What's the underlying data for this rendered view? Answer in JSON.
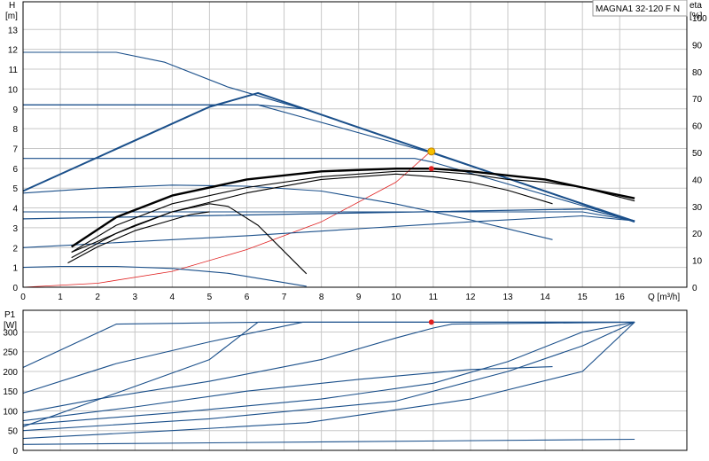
{
  "colors": {
    "curve": "#1a4f8a",
    "eta": "#000000",
    "system": "#e02020",
    "point": "#e02020",
    "point_top": "#f5c000",
    "grid": "#c8c8c8",
    "frame": "#000000"
  },
  "chart_data": [
    {
      "type": "line",
      "title": "MAGNA1 32-120 F N",
      "ylabel": "H",
      "yunit": "[m]",
      "y2label": "eta",
      "y2unit": "[%]",
      "xlabel": "Q [m³/h]",
      "xlim": [
        0,
        17.8
      ],
      "ylim": [
        0,
        14.4
      ],
      "y2lim": [
        0,
        100
      ],
      "x_ticks": [
        "0",
        "1",
        "2",
        "3",
        "4",
        "5",
        "6",
        "7",
        "8",
        "9",
        "10",
        "11",
        "12",
        "13",
        "14",
        "15",
        "16"
      ],
      "y_ticks": [
        "0",
        "1",
        "2",
        "3",
        "4",
        "5",
        "6",
        "7",
        "8",
        "9",
        "10",
        "11",
        "12",
        "13"
      ],
      "y2_ticks": [
        "0",
        "10",
        "20",
        "30",
        "40",
        "50",
        "60",
        "70",
        "80",
        "90",
        "100"
      ],
      "grid": true,
      "head_curves": [
        {
          "x": [
            0,
            2.5,
            3.8,
            5.5,
            7.5
          ],
          "y": [
            11.85,
            11.85,
            11.35,
            10.1,
            9.0
          ]
        },
        {
          "x": [
            0,
            6.3,
            10.9,
            16.4
          ],
          "y": [
            9.2,
            9.2,
            6.8,
            3.35
          ]
        },
        {
          "x": [
            0,
            6.3,
            7.5
          ],
          "y": [
            9.2,
            9.2,
            9.0
          ]
        },
        {
          "x": [
            0,
            10.5,
            11,
            16.4
          ],
          "y": [
            6.5,
            6.5,
            6.3,
            3.35
          ]
        },
        {
          "x": [
            0,
            2,
            4,
            6,
            8,
            10,
            12,
            14.2
          ],
          "y": [
            4.75,
            5.0,
            5.15,
            5.1,
            4.85,
            4.2,
            3.4,
            2.4
          ]
        },
        {
          "x": [
            0,
            2,
            5,
            10,
            15,
            16.4
          ],
          "y": [
            3.8,
            3.8,
            3.8,
            3.8,
            3.8,
            3.35
          ]
        },
        {
          "x": [
            0,
            3,
            6,
            9,
            12,
            15,
            16.4
          ],
          "y": [
            2.0,
            2.3,
            2.6,
            2.95,
            3.3,
            3.6,
            3.35
          ]
        },
        {
          "x": [
            0,
            1,
            2.5,
            4,
            5.5,
            7.6
          ],
          "y": [
            1.0,
            1.05,
            1.05,
            0.95,
            0.7,
            0.05
          ]
        }
      ],
      "max_head_limit": {
        "x": [
          0,
          5,
          6.3,
          16.4
        ],
        "y": [
          4.85,
          9.1,
          9.8,
          3.3
        ]
      },
      "min_head_limit": {
        "x": [
          0,
          15.1,
          16.4
        ],
        "y": [
          3.45,
          3.95,
          3.35
        ]
      },
      "eta_curves": [
        {
          "name": "",
          "x": [
            1.3,
            2.5,
            4,
            6,
            8,
            10,
            11,
            12,
            14,
            15,
            16.4
          ],
          "y": [
            15,
            26,
            34,
            40,
            43,
            44,
            44,
            43,
            40,
            37,
            33
          ]
        },
        {
          "name": "",
          "x": [
            1.3,
            2.5,
            4,
            6,
            8,
            9,
            10,
            11,
            12,
            13,
            14,
            15,
            16.4
          ],
          "y": [
            13,
            23,
            31,
            37,
            41,
            42,
            43,
            43,
            42,
            40,
            39,
            37,
            32
          ]
        },
        {
          "name": "",
          "x": [
            1.3,
            2.5,
            4,
            6,
            8,
            9,
            10,
            11,
            12,
            13,
            14.2
          ],
          "y": [
            11,
            20,
            28,
            35,
            40,
            41,
            42,
            41,
            39,
            36,
            31
          ]
        },
        {
          "name": "",
          "x": [
            1.3,
            2,
            3,
            4,
            5,
            5.5,
            6.3,
            7.6
          ],
          "y": [
            13,
            17,
            23,
            28,
            31,
            30,
            23,
            5
          ]
        },
        {
          "name": "",
          "x": [
            1.2,
            2,
            3,
            4,
            4.5,
            5
          ],
          "y": [
            9,
            15,
            21,
            25,
            27,
            28
          ]
        }
      ],
      "system_curve": {
        "x": [
          0,
          2,
          4,
          6,
          8,
          10,
          10.9
        ],
        "y": [
          0,
          0.2,
          0.8,
          1.9,
          3.3,
          5.3,
          6.8
        ]
      },
      "duty_point": {
        "x": 10.95,
        "y": 6.85
      },
      "eta_point": {
        "x": 10.95,
        "y": 44
      }
    },
    {
      "type": "line",
      "ylabel": "P1",
      "yunit": "[W]",
      "xlim": [
        0,
        17.8
      ],
      "ylim": [
        0,
        355
      ],
      "y_ticks": [
        "0",
        "50",
        "100",
        "150",
        "200",
        "250",
        "300"
      ],
      "grid": true,
      "power_curves": [
        {
          "x": [
            0,
            2.5,
            6.4,
            16.4
          ],
          "y": [
            210,
            320,
            325,
            325
          ]
        },
        {
          "x": [
            0,
            2.5,
            5,
            7.5,
            16.4
          ],
          "y": [
            145,
            220,
            275,
            325,
            325
          ]
        },
        {
          "x": [
            0,
            5,
            6.3,
            16.4
          ],
          "y": [
            60,
            230,
            325,
            325
          ]
        },
        {
          "x": [
            0,
            2,
            5,
            8,
            10,
            11,
            11.5,
            16.4
          ],
          "y": [
            95,
            130,
            175,
            230,
            285,
            310,
            320,
            325
          ]
        },
        {
          "x": [
            0,
            3,
            6,
            9,
            12,
            14.2
          ],
          "y": [
            75,
            110,
            150,
            180,
            205,
            212
          ]
        },
        {
          "x": [
            0,
            4,
            8,
            11,
            13,
            15,
            16.4
          ],
          "y": [
            65,
            95,
            130,
            170,
            225,
            300,
            325
          ]
        },
        {
          "x": [
            0,
            5,
            10,
            13,
            15,
            16.4
          ],
          "y": [
            50,
            80,
            125,
            200,
            265,
            325
          ]
        },
        {
          "x": [
            0,
            4,
            7.6,
            12,
            15,
            16.4
          ],
          "y": [
            30,
            50,
            70,
            130,
            200,
            325
          ]
        },
        {
          "x": [
            0,
            16.4
          ],
          "y": [
            15,
            28
          ]
        }
      ],
      "duty_point": {
        "x": 10.95,
        "y": 325
      }
    }
  ]
}
